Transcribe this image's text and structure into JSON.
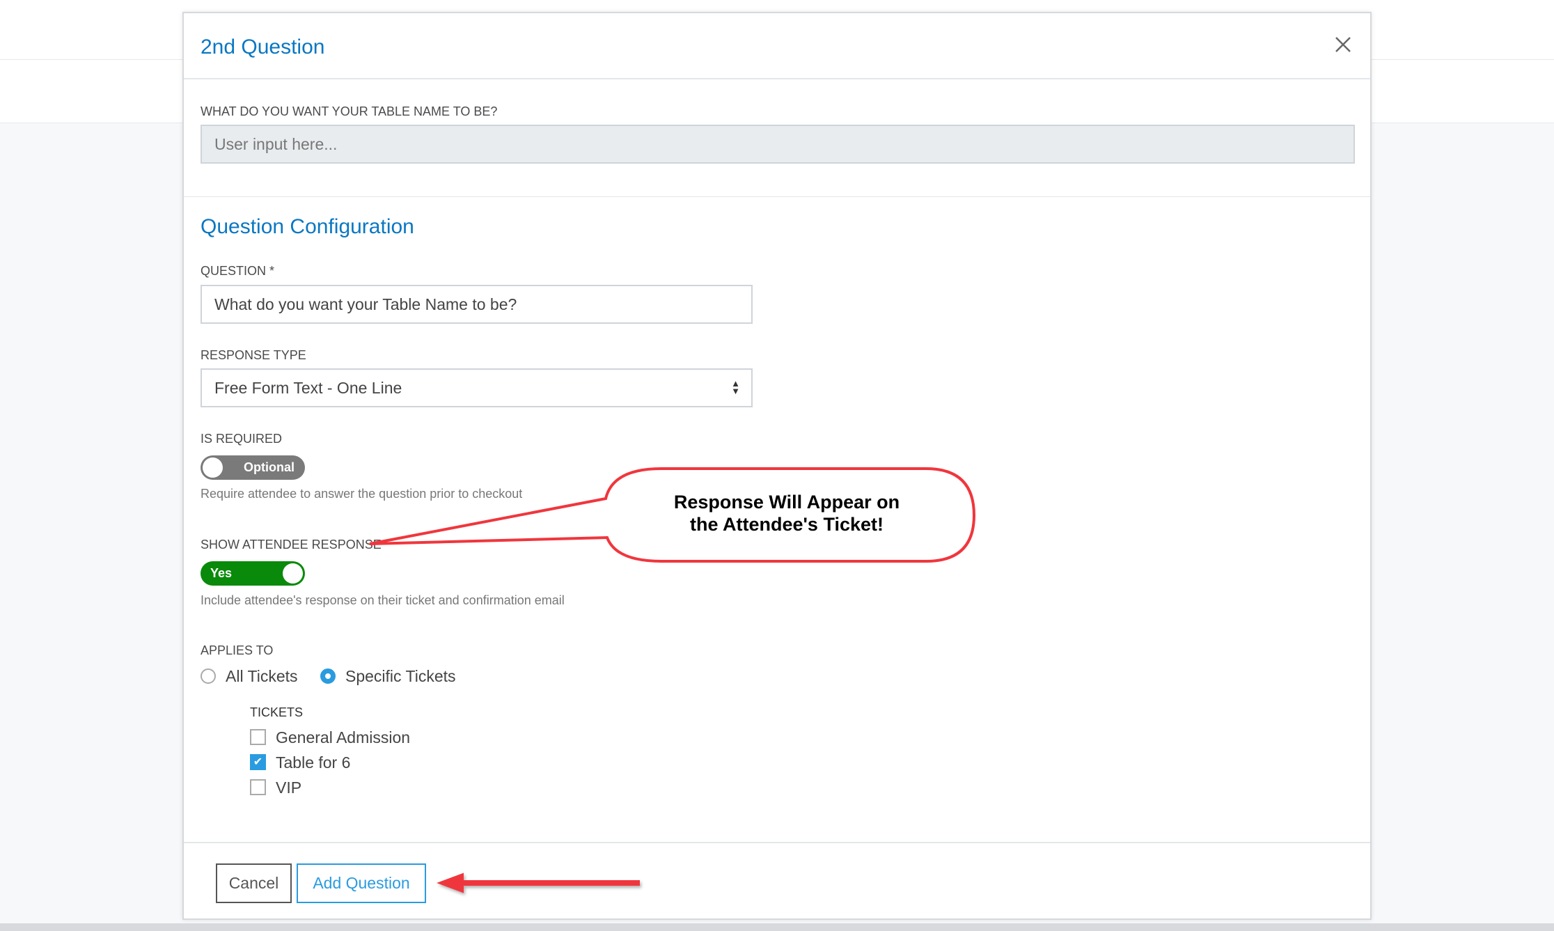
{
  "modal": {
    "title": "2nd Question",
    "close_icon": "close-icon",
    "preview": {
      "label": "WHAT DO YOU WANT YOUR TABLE NAME TO BE?",
      "placeholder": "User input here..."
    },
    "section_title": "Question Configuration",
    "question": {
      "label": "QUESTION *",
      "value": "What do you want your Table Name to be?"
    },
    "response_type": {
      "label": "RESPONSE TYPE",
      "value": "Free Form Text - One Line"
    },
    "is_required": {
      "label": "IS REQUIRED",
      "toggle_label": "Optional",
      "on": false,
      "help": "Require attendee to answer the question prior to checkout"
    },
    "show_response": {
      "label": "SHOW ATTENDEE RESPONSE",
      "toggle_label": "Yes",
      "on": true,
      "help": "Include attendee's response on their ticket and confirmation email"
    },
    "applies_to": {
      "label": "APPLIES TO",
      "options": [
        "All Tickets",
        "Specific Tickets"
      ],
      "selected": "Specific Tickets"
    },
    "tickets": {
      "label": "TICKETS",
      "items": [
        {
          "label": "General Admission",
          "checked": false
        },
        {
          "label": "Table for 6",
          "checked": true
        },
        {
          "label": "VIP",
          "checked": false
        }
      ]
    },
    "footer": {
      "cancel": "Cancel",
      "add": "Add Question"
    }
  },
  "annotation": {
    "callout_line1": "Response Will Appear on",
    "callout_line2": "the Attendee's Ticket!",
    "color": "#f0363d"
  },
  "colors": {
    "accent": "#0a77c2",
    "toggle_on": "#0a8a0a",
    "toggle_off": "#7a7a7a",
    "checkbox": "#2a9be0"
  }
}
